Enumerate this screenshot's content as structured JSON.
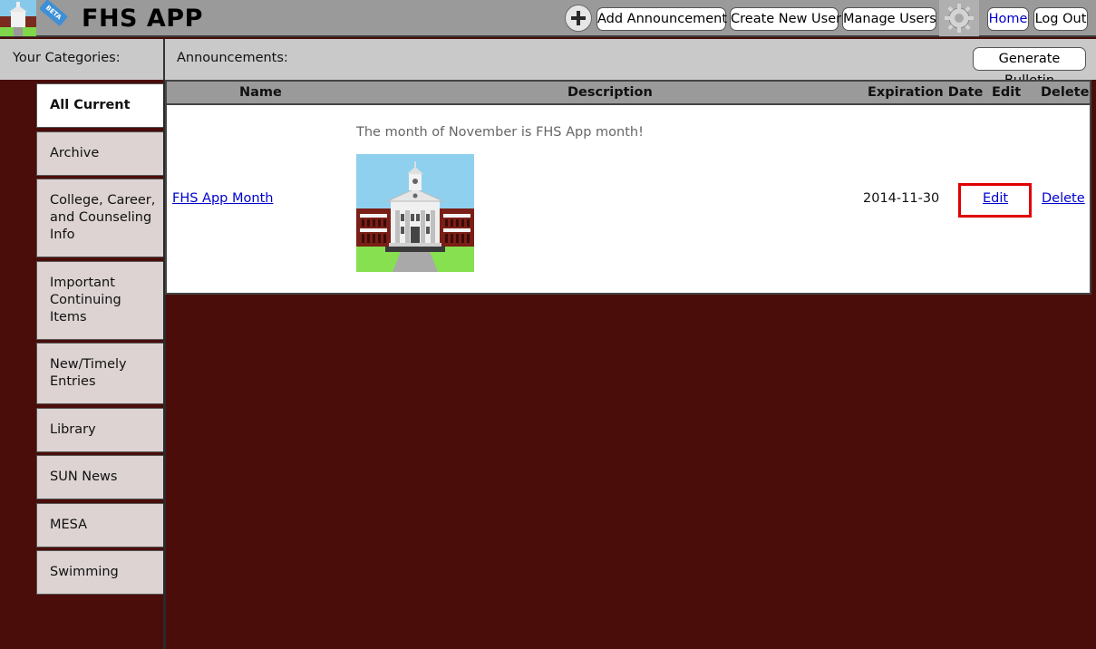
{
  "app": {
    "title": "FHS APP",
    "beta_label": "BETA"
  },
  "toolbar": {
    "add_icon": "plus-icon",
    "add_announcement": "Add Announcement",
    "create_user": "Create New User",
    "manage_users": "Manage Users",
    "settings_icon": "gear-icon",
    "home": "Home",
    "logout": "Log Out"
  },
  "sidebar": {
    "header": "Your Categories:",
    "items": [
      {
        "label": "All Current",
        "active": true
      },
      {
        "label": "Archive"
      },
      {
        "label": "College, Career, and Counseling Info"
      },
      {
        "label": "Important Continuing Items"
      },
      {
        "label": "New/Timely Entries"
      },
      {
        "label": "Library"
      },
      {
        "label": "SUN News"
      },
      {
        "label": "MESA"
      },
      {
        "label": "Swimming"
      }
    ]
  },
  "announcements": {
    "header": "Announcements:",
    "generate_bulletin": "Generate Bulletin",
    "columns": [
      "Name",
      "Description",
      "Expiration Date",
      "Edit",
      "Delete"
    ],
    "rows": [
      {
        "name": "FHS App Month",
        "description": "The month of November is FHS App month!",
        "image_icon": "school-building-image",
        "expiration": "2014-11-30",
        "edit": "Edit",
        "delete": "Delete"
      }
    ]
  },
  "colors": {
    "background": "#4a0d0a",
    "topbar": "#9a9a9a",
    "panel": "#c9c9c9",
    "category": "#dcd3d2",
    "link": "#0000cc",
    "highlight": "#e00000"
  }
}
